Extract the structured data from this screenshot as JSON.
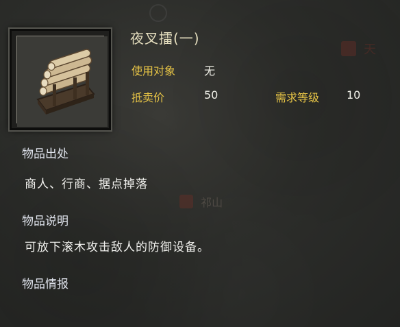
{
  "item": {
    "name": "夜叉擂(一)",
    "target_label": "使用对象",
    "target_value": "无",
    "price_label": "抵卖价",
    "price_value": "50",
    "level_label": "需求等级",
    "level_value": "10"
  },
  "sections": {
    "origin_title": "物品出处",
    "origin_text": "商人、行商、据点掉落",
    "desc_title": "物品说明",
    "desc_text": "可放下滚木攻击敌人的防御设备。",
    "info_title": "物品情报"
  },
  "background": {
    "map_label_1": "天",
    "map_label_2": "祁山"
  },
  "colors": {
    "label_gold": "#e7c446",
    "title_cream": "#e6dfbf",
    "section_blue_white": "#dfe3ec"
  }
}
